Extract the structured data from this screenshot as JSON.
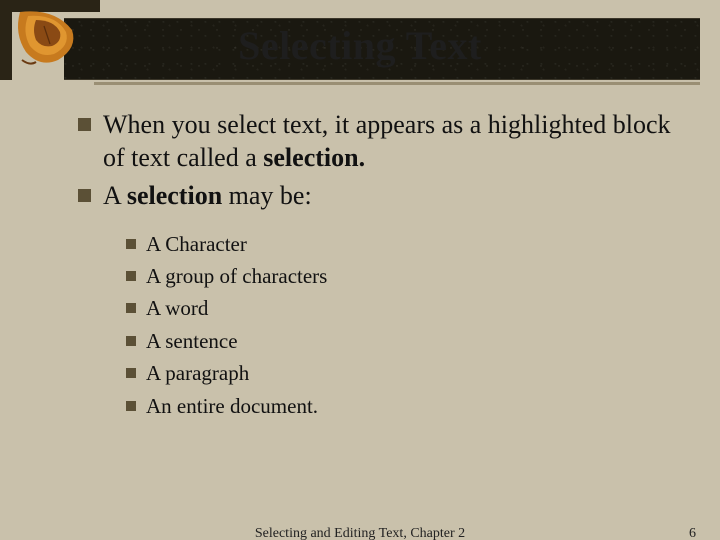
{
  "title": "Selecting Text",
  "bullets": [
    {
      "pre": "When you select text, it appears as a highlighted block of text called a ",
      "bold": "selection.",
      "post": ""
    },
    {
      "pre": "A ",
      "bold": "selection",
      "post": " may be:"
    }
  ],
  "sublist": [
    "A Character",
    "A group of characters",
    "A word",
    "A sentence",
    "A paragraph",
    "An entire document."
  ],
  "footer": {
    "center": "Selecting and Editing Text, Chapter 2",
    "pagenum": "6"
  },
  "icons": {
    "leaf": "leaf-corner-icon",
    "bullet": "square-bullet-icon"
  }
}
